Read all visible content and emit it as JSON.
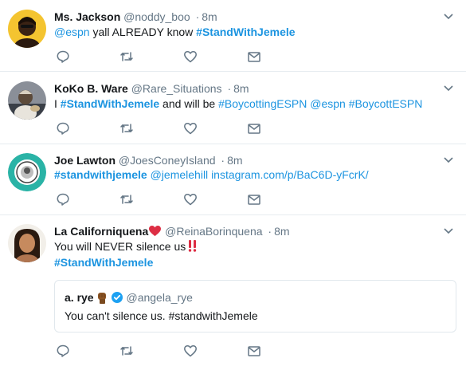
{
  "tweets": [
    {
      "name": "Ms. Jackson",
      "handle": "@noddy_boo",
      "time": "8m",
      "mention1": "@espn",
      "text1": " yall ALREADY know ",
      "tag1": "#StandWithJemele"
    },
    {
      "name": "KoKo B. Ware",
      "handle": "@Rare_Situations",
      "time": "8m",
      "text1": "I ",
      "tag1": "#StandWithJemele",
      "text2": " and will be ",
      "tag2": "#BoycottingESPN",
      "mention1": "@espn",
      "tag3": "#BoycottESPN"
    },
    {
      "name": "Joe Lawton",
      "handle": "@JoesConeyIsland",
      "time": "8m",
      "tag1": "#standwithjemele",
      "mention1": "@jemelehill",
      "link": "instagram.com/p/BaC6D-yFcrK/"
    },
    {
      "name": "La Californiquena",
      "handle": "@ReinaBorinquena",
      "time": "8m",
      "text1": "You will NEVER silence us",
      "tag1": "#StandWithJemele",
      "quote": {
        "name": "a. rye",
        "handle": "@angela_rye",
        "text": "You can't silence us. #standwithJemele"
      }
    }
  ],
  "sep": "·",
  "icons": {
    "reply": "reply-icon",
    "retweet": "retweet-icon",
    "like": "heart-icon",
    "dm": "envelope-icon",
    "caret": "chevron-down-icon"
  },
  "colors": {
    "link": "#1c94e0",
    "icon": "#657786",
    "verified": "#1da1f2",
    "heart": "#dd2e44"
  }
}
